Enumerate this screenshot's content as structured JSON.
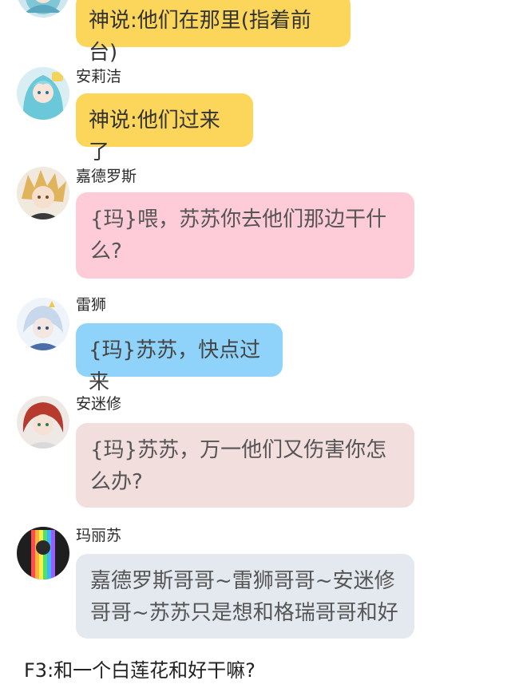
{
  "messages": [
    {
      "name": "",
      "text": "神说:他们在那里(指着前台)",
      "color": "#fbd65a"
    },
    {
      "name": "安莉洁",
      "text": "神说:他们过来了",
      "color": "#fbd65a"
    },
    {
      "name": "嘉德罗斯",
      "text": "{玛}喂，苏苏你去他们那边干什么?",
      "color": "#fecbd8"
    },
    {
      "name": "雷狮",
      "text": "{玛}苏苏，快点过来",
      "color": "#8fd3fb"
    },
    {
      "name": "安迷修",
      "text": "{玛}苏苏，万一他们又伤害你怎么办?",
      "color": "#f3dede"
    },
    {
      "name": "玛丽苏",
      "text": "嘉德罗斯哥哥~雷狮哥哥~安迷修哥哥~苏苏只是想和格瑞哥哥和好",
      "color": "#e4e9f0"
    }
  ],
  "footer": {
    "text": "F3:和一个白莲花和好干嘛?"
  }
}
